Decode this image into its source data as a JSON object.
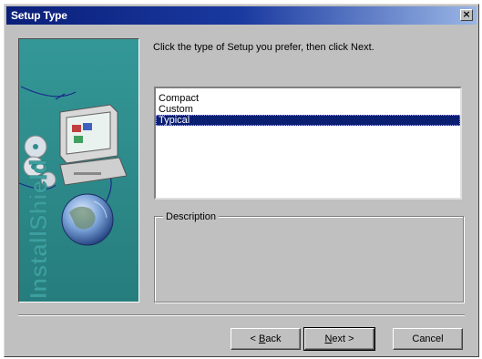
{
  "window": {
    "title": "Setup Type",
    "close_glyph": "×"
  },
  "side_panel": {
    "brand_text": "InstallShield",
    "accent_color": "#2e8d8d",
    "icons": [
      "computer-icon",
      "cd-disc-icon",
      "globe-icon"
    ]
  },
  "main": {
    "prompt": "Click the type of Setup you prefer, then click Next.",
    "options": [
      "Compact",
      "Custom",
      "Typical"
    ],
    "selected_option": "Typical",
    "description_label": "Description",
    "description_text": ""
  },
  "buttons": {
    "back_prefix": "< ",
    "back_mnemonic": "B",
    "back_rest": "ack",
    "next_mnemonic": "N",
    "next_rest": "ext >",
    "cancel_label": "Cancel"
  },
  "colors": {
    "titlebar_start": "#0a1f7a",
    "selection": "#0a1e72",
    "face": "#c0c0c0"
  }
}
